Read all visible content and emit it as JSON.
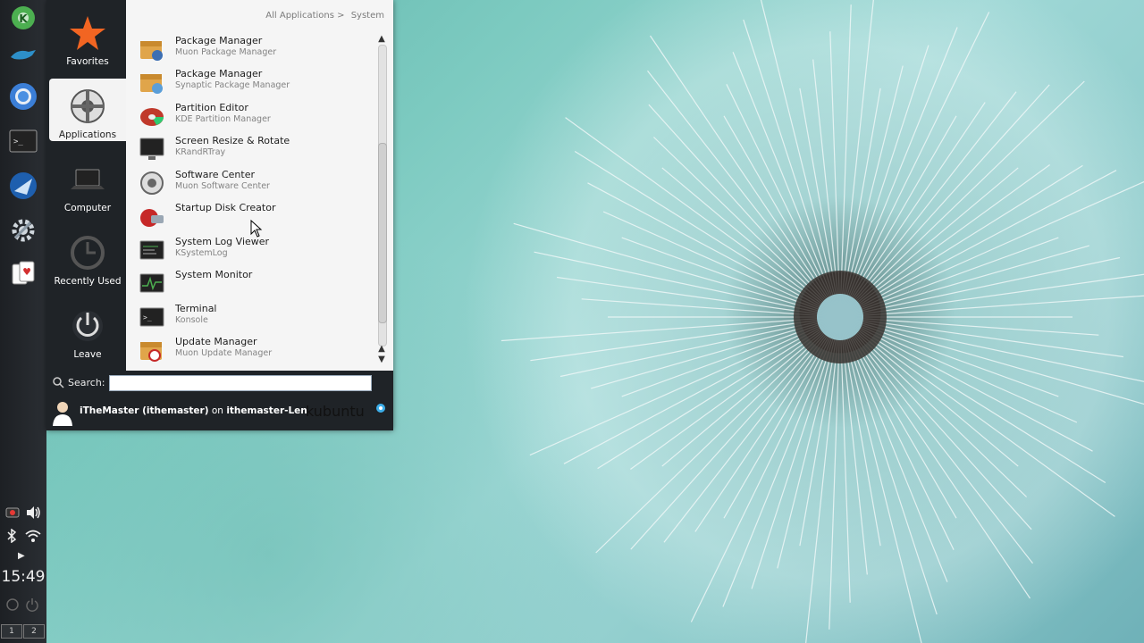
{
  "panel": {
    "clock": "15:49",
    "desktops": [
      "1",
      "2"
    ],
    "launchers": [
      "kde-icon",
      "dolphin-icon",
      "chromium-icon",
      "terminal-icon",
      "thunderbird-icon",
      "settings-icon",
      "cards-icon"
    ]
  },
  "menu": {
    "breadcrumb": {
      "root": "All Applications >",
      "current": "System"
    },
    "categories": [
      {
        "label": "Favorites"
      },
      {
        "label": "Applications"
      },
      {
        "label": "Computer"
      },
      {
        "label": "Recently Used"
      },
      {
        "label": "Leave"
      }
    ],
    "items": [
      {
        "title": "Package Manager",
        "subtitle": "Muon Package Manager"
      },
      {
        "title": "Package Manager",
        "subtitle": "Synaptic Package Manager"
      },
      {
        "title": "Partition Editor",
        "subtitle": "KDE Partition Manager"
      },
      {
        "title": "Screen Resize & Rotate",
        "subtitle": "KRandRTray"
      },
      {
        "title": "Software Center",
        "subtitle": "Muon Software Center"
      },
      {
        "title": "Startup Disk Creator",
        "subtitle": ""
      },
      {
        "title": "System Log Viewer",
        "subtitle": "KSystemLog"
      },
      {
        "title": "System Monitor",
        "subtitle": ""
      },
      {
        "title": "Terminal",
        "subtitle": "Konsole"
      },
      {
        "title": "Update Manager",
        "subtitle": "Muon Update Manager"
      }
    ],
    "search": {
      "label": "Search:",
      "value": ""
    },
    "user": {
      "name": "iTheMaster (ithemaster)",
      "on": "on",
      "host": "ithemaster-Lenovo"
    },
    "brand": "kubuntu"
  },
  "colors": {
    "accent": "#3daee9",
    "panel": "#1f2327",
    "list_bg": "#f5f5f5"
  }
}
